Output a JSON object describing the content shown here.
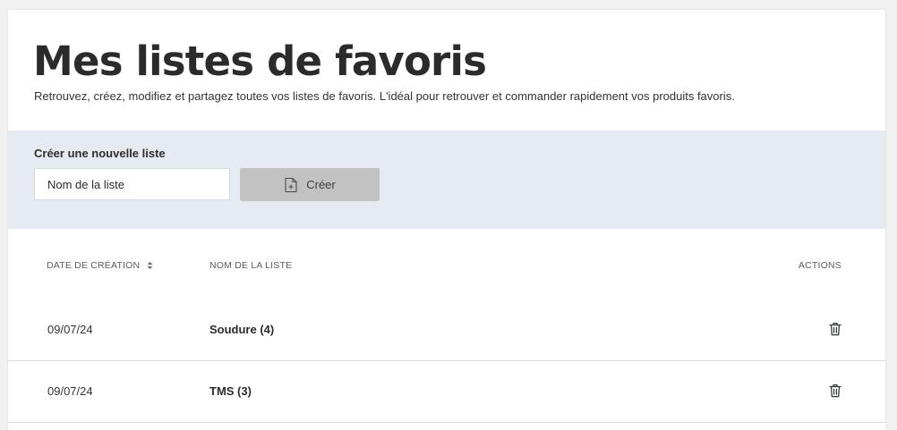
{
  "header": {
    "title": "Mes listes de favoris",
    "subtitle": "Retrouvez, créez, modifiez et partagez toutes vos listes de favoris. L'idéal pour retrouver et commander rapidement vos produits favoris."
  },
  "create": {
    "label": "Créer une nouvelle liste",
    "input_placeholder": "Nom de la liste",
    "input_value": "",
    "button_label": "Créer",
    "button_icon": "file-plus-icon",
    "button_color": "#c2c2c2",
    "panel_color": "#e6ebf2"
  },
  "table": {
    "columns": {
      "date": "DATE DE CRÉATION",
      "date_sort_icon": "sort-icon",
      "name": "NOM DE LA LISTE",
      "actions": "ACTIONS"
    },
    "rows": [
      {
        "date": "09/07/24",
        "name": "Soudure (4)",
        "action_icon": "trash-icon"
      },
      {
        "date": "09/07/24",
        "name": "TMS (3)",
        "action_icon": "trash-icon"
      }
    ]
  }
}
